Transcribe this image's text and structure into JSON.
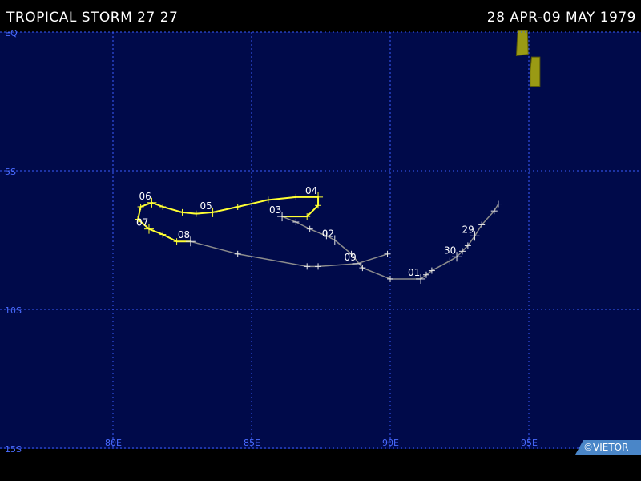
{
  "header": {
    "title": "TROPICAL STORM 27 27",
    "date_range": "28 APR-09 MAY 1979"
  },
  "map": {
    "lon_range": [
      76,
      98
    ],
    "lat_range": [
      0,
      -15
    ],
    "gridlines": {
      "lon": [
        {
          "value": 80,
          "label": "80E"
        },
        {
          "value": 85,
          "label": "85E"
        },
        {
          "value": 90,
          "label": "90E"
        },
        {
          "value": 95,
          "label": "95E"
        }
      ],
      "lat": [
        {
          "value": 0,
          "label": "EQ"
        },
        {
          "value": -5,
          "label": "5S"
        },
        {
          "value": -10,
          "label": "10S"
        },
        {
          "value": -15,
          "label": "15S"
        }
      ]
    },
    "colors": {
      "ocean": "#000a4a",
      "grid": "#3a5cff",
      "grid_label": "#4a6cff",
      "land_fill": "#9a9a14",
      "land_edge": "#5a5a08",
      "track_weak": "#8c8c8c",
      "track_storm": "#ffff33",
      "marker": "#e6e6e6"
    },
    "land": [
      {
        "name": "",
        "lon_lat": [
          [
            94.6,
            0.05
          ],
          [
            94.95,
            0.05
          ],
          [
            94.98,
            -0.8
          ],
          [
            94.55,
            -0.85
          ]
        ]
      },
      {
        "name": "",
        "lon_lat": [
          [
            95.1,
            -0.9
          ],
          [
            95.4,
            -0.9
          ],
          [
            95.4,
            -1.95
          ],
          [
            95.05,
            -1.95
          ],
          [
            95.05,
            -1.4
          ]
        ]
      }
    ],
    "track": [
      {
        "lon": 93.9,
        "lat": -6.2,
        "intensity": "weak"
      },
      {
        "lon": 93.75,
        "lat": -6.45,
        "intensity": "weak"
      },
      {
        "lon": 93.3,
        "lat": -6.95,
        "intensity": "weak"
      },
      {
        "lon": 93.05,
        "lat": -7.35,
        "intensity": "weak",
        "label": "29"
      },
      {
        "lon": 92.8,
        "lat": -7.7,
        "intensity": "weak"
      },
      {
        "lon": 92.6,
        "lat": -7.9,
        "intensity": "weak"
      },
      {
        "lon": 92.4,
        "lat": -8.1,
        "intensity": "weak",
        "label": "30"
      },
      {
        "lon": 92.15,
        "lat": -8.25,
        "intensity": "weak"
      },
      {
        "lon": 91.5,
        "lat": -8.6,
        "intensity": "weak"
      },
      {
        "lon": 91.3,
        "lat": -8.75,
        "intensity": "weak"
      },
      {
        "lon": 91.1,
        "lat": -8.9,
        "intensity": "weak",
        "label": "01"
      },
      {
        "lon": 90,
        "lat": -8.9,
        "intensity": "weak"
      },
      {
        "lon": 89.0,
        "lat": -8.5,
        "intensity": "weak"
      },
      {
        "lon": 88.6,
        "lat": -8.0,
        "intensity": "weak"
      },
      {
        "lon": 88.0,
        "lat": -7.5,
        "intensity": "weak",
        "label": "02"
      },
      {
        "lon": 87.7,
        "lat": -7.35,
        "intensity": "weak"
      },
      {
        "lon": 87.1,
        "lat": -7.1,
        "intensity": "weak"
      },
      {
        "lon": 86.6,
        "lat": -6.85,
        "intensity": "weak"
      },
      {
        "lon": 86.1,
        "lat": -6.65,
        "intensity": "weak",
        "label": "03"
      },
      {
        "lon": 87.0,
        "lat": -6.65,
        "intensity": "storm"
      },
      {
        "lon": 87.4,
        "lat": -6.25,
        "intensity": "storm"
      },
      {
        "lon": 87.4,
        "lat": -5.95,
        "intensity": "storm",
        "label": "04"
      },
      {
        "lon": 86.6,
        "lat": -5.95,
        "intensity": "storm"
      },
      {
        "lon": 85.6,
        "lat": -6.05,
        "intensity": "storm"
      },
      {
        "lon": 84.5,
        "lat": -6.3,
        "intensity": "storm"
      },
      {
        "lon": 83.6,
        "lat": -6.5,
        "intensity": "storm",
        "label": "05"
      },
      {
        "lon": 83.0,
        "lat": -6.55,
        "intensity": "storm"
      },
      {
        "lon": 82.5,
        "lat": -6.5,
        "intensity": "storm"
      },
      {
        "lon": 81.8,
        "lat": -6.3,
        "intensity": "storm"
      },
      {
        "lon": 81.4,
        "lat": -6.15,
        "intensity": "storm",
        "label": "06"
      },
      {
        "lon": 81.0,
        "lat": -6.3,
        "intensity": "storm"
      },
      {
        "lon": 80.9,
        "lat": -6.75,
        "intensity": "storm"
      },
      {
        "lon": 81.3,
        "lat": -7.1,
        "intensity": "storm",
        "label": "07"
      },
      {
        "lon": 81.8,
        "lat": -7.3,
        "intensity": "storm"
      },
      {
        "lon": 82.3,
        "lat": -7.55,
        "intensity": "storm"
      },
      {
        "lon": 82.8,
        "lat": -7.55,
        "intensity": "weak",
        "label": "08"
      },
      {
        "lon": 84.5,
        "lat": -8.0,
        "intensity": "weak"
      },
      {
        "lon": 87.0,
        "lat": -8.45,
        "intensity": "weak"
      },
      {
        "lon": 87.4,
        "lat": -8.45,
        "intensity": "weak"
      },
      {
        "lon": 88.8,
        "lat": -8.35,
        "intensity": "weak",
        "label": "09"
      },
      {
        "lon": 89.9,
        "lat": -8.0,
        "intensity": "weak"
      }
    ]
  },
  "credit": "©VIETOR"
}
